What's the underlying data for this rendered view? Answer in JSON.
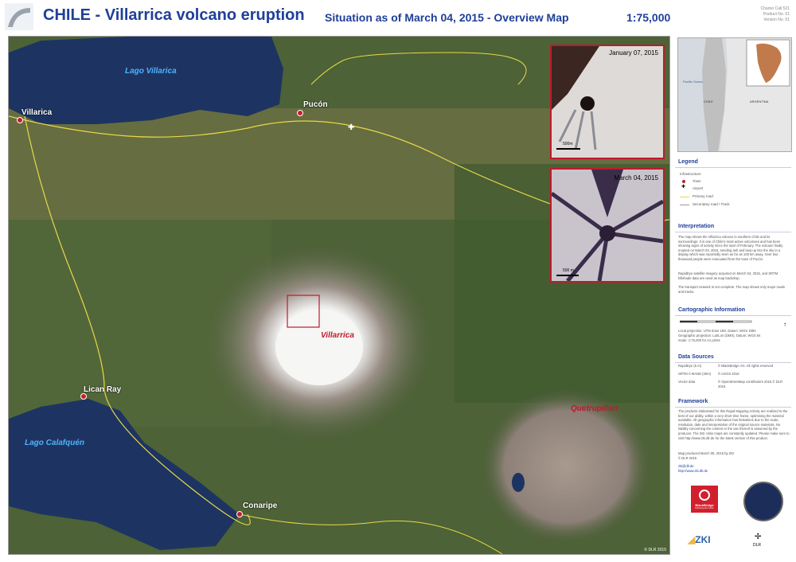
{
  "header": {
    "title": "CHILE - Villarrica volcano eruption",
    "situation": "Situation as of March 04, 2015 - Overview Map",
    "scale": "1:75,000",
    "meta": [
      "Charter Call 521",
      "Product No. 01",
      "Version No. 01"
    ]
  },
  "map": {
    "lakes": {
      "villarica": "Lago Villarica",
      "calafquen": "Lago Calafquén"
    },
    "towns": {
      "villarica": "Villarica",
      "pucon": "Pucón",
      "lican_ray": "Lican Ray",
      "conaripe": "Conaripe"
    },
    "volcanoes": {
      "villarrica": "Villarrica",
      "quetrupillan": "Quetrupillan"
    },
    "inset1_date": "January 07, 2015",
    "inset2_date": "March 04, 2015",
    "inset1_scale": "500m",
    "inset2_scale": "500 m",
    "copyright": "© DLR 2015",
    "colors": {
      "accent": "#c0192c",
      "title": "#1f3f99",
      "road": "#e8d84a"
    }
  },
  "sidebar": {
    "overview_labels": {
      "ocean": "Pacific Ocean",
      "chile": "CHILE",
      "argentina": "ARGENTINA"
    },
    "legend": {
      "title": "Legend",
      "subtitle": "Infrastructure",
      "items": [
        "Town",
        "Airport",
        "Primary road",
        "Secondary road / Track"
      ]
    },
    "interpretation": {
      "title": "Interpretation",
      "text": "The map shows the Villarrica volcano in southern Chile and its surroundings. It is one of Chile's most active volcanoes and has been showing signs of activity since the start of February. The volcano finally erupted on March 03, 2015, sending ash and lava up into the sky in a display which was reportedly seen as far as 100 km away. Over two thousand people were evacuated from the town of Pucón.",
      "text2": "RapidEye satellite imagery acquired on March 04, 2015, and SRTM hillshade data are used as map backdrop.",
      "text3": "The transport network is not complete. The map shows only major roads and tracks."
    },
    "cartographic": {
      "title": "Cartographic Information",
      "lines": [
        "Local projection: UTM Zone 18S, Datum: WGS 1984",
        "Geographic projection: Lat/Lon (DMS), Datum: WGS 84",
        "Scale: 1:75,000 for A1 prints"
      ]
    },
    "data_sources": {
      "title": "Data Sources",
      "rows": [
        [
          "RapidEye (5 m)",
          "© BlackBridge AG. All rights reserved"
        ],
        [
          "SRTM C-BAND (30m)",
          "© USGS 2015"
        ],
        [
          "Vector data",
          "© OpenStreetMap contributors 2015 © DLR 2015"
        ]
      ]
    },
    "framework": {
      "title": "Framework",
      "text": "The products elaborated for this Rapid Mapping Activity are realized to the best of our ability, within a very short time frame, optimising the material available. All geographic information has limitations due to the scale, resolution, date and interpretation of the original source materials. No liability concerning the content or the use thereof is assumed by the producer. The ZKI crisis maps are constantly updated. Please make sure to visit http://www.zki.dlr.de for the latest version of this product.",
      "map_produced": "Map produced March 05, 2015 by ZKI",
      "dlr": "© DLR 2015",
      "contact": "zki@dlr.de",
      "url": "http://www.zki.dlr.de"
    },
    "logos": {
      "blackbridge": "BlackBridge",
      "blackbridge_tag": "Delivering the Future",
      "zki": "ZKI",
      "dlr": "DLR"
    }
  }
}
